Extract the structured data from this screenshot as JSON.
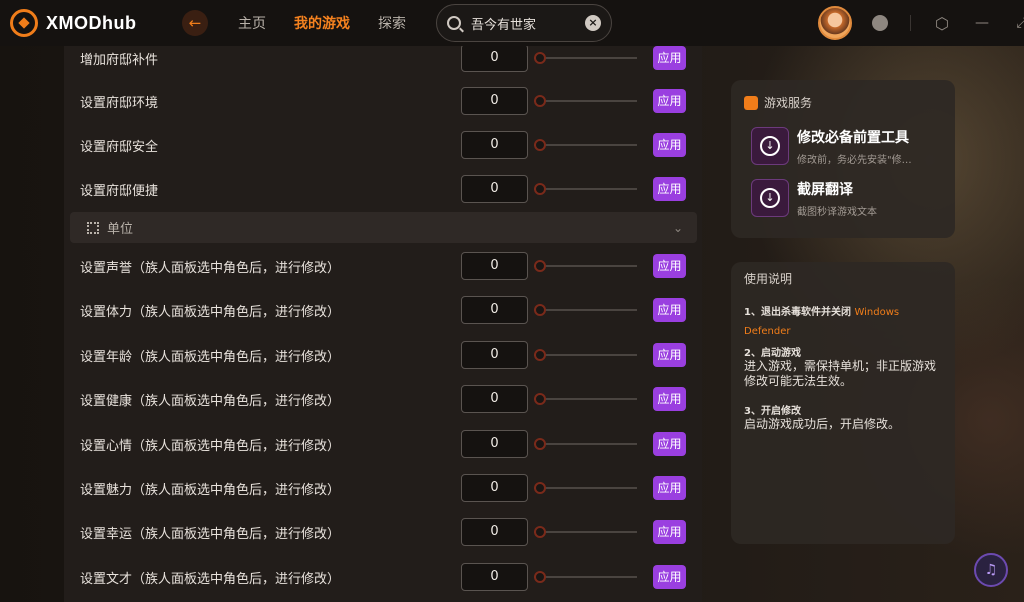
{
  "app": {
    "name": "XMODhub"
  },
  "nav": {
    "back_icon": "back-arrow-icon",
    "items": [
      {
        "label": "主页",
        "active": false
      },
      {
        "label": "我的游戏",
        "active": true
      },
      {
        "label": "探索",
        "active": false
      }
    ]
  },
  "search": {
    "value": "吾今有世家",
    "placeholder": ""
  },
  "colors": {
    "accent": "#f5821f",
    "apply": "#9a3fe0",
    "panel": "#221d1a"
  },
  "list": {
    "apply_label": "应用",
    "rows_top": [
      {
        "label": "增加府邸补件",
        "value": "0"
      },
      {
        "label": "设置府邸环境",
        "value": "0"
      },
      {
        "label": "设置府邸安全",
        "value": "0"
      },
      {
        "label": "设置府邸便捷",
        "value": "0"
      }
    ],
    "section": {
      "title": "单位"
    },
    "rows_unit": [
      {
        "label": "设置声誉（族人面板选中角色后，进行修改）",
        "value": "0"
      },
      {
        "label": "设置体力（族人面板选中角色后，进行修改）",
        "value": "0"
      },
      {
        "label": "设置年龄（族人面板选中角色后，进行修改）",
        "value": "0"
      },
      {
        "label": "设置健康（族人面板选中角色后，进行修改）",
        "value": "0"
      },
      {
        "label": "设置心情（族人面板选中角色后，进行修改）",
        "value": "0"
      },
      {
        "label": "设置魅力（族人面板选中角色后，进行修改）",
        "value": "0"
      },
      {
        "label": "设置幸运（族人面板选中角色后，进行修改）",
        "value": "0"
      },
      {
        "label": "设置文才（族人面板选中角色后，进行修改）",
        "value": "0"
      }
    ]
  },
  "services": {
    "title": "游戏服务",
    "items": [
      {
        "name": "修改必备前置工具",
        "desc": "修改前，务必先安装\"修…"
      },
      {
        "name": "截屏翻译",
        "desc": "截图秒译游戏文本"
      }
    ]
  },
  "help": {
    "title": "使用说明",
    "steps": [
      {
        "head": "1、退出杀毒软件并关闭 ",
        "accent": "Windows Defender",
        "body": ""
      },
      {
        "head": "2、启动游戏",
        "accent": "",
        "body": "进入游戏，需保持单机；非正版游戏修改可能无法生效。"
      },
      {
        "head": "3、开启修改",
        "accent": "",
        "body": "启动游戏成功后，开启修改。"
      }
    ]
  }
}
